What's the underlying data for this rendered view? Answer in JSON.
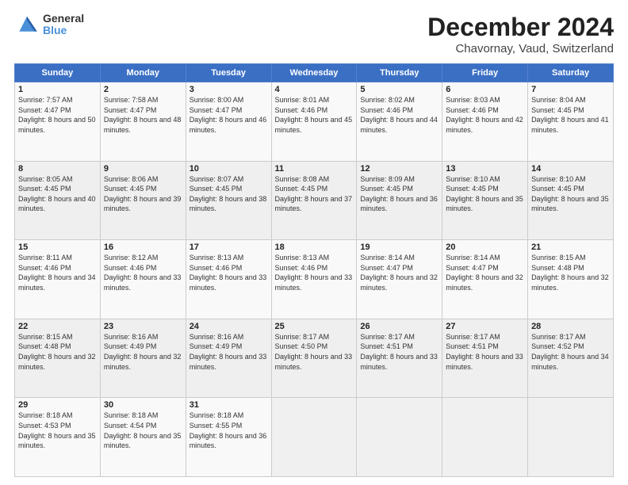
{
  "logo": {
    "line1": "General",
    "line2": "Blue"
  },
  "title": "December 2024",
  "subtitle": "Chavornay, Vaud, Switzerland",
  "days_header": [
    "Sunday",
    "Monday",
    "Tuesday",
    "Wednesday",
    "Thursday",
    "Friday",
    "Saturday"
  ],
  "weeks": [
    [
      {
        "num": "1",
        "rise": "7:57 AM",
        "set": "4:47 PM",
        "daylight": "8 hours and 50 minutes."
      },
      {
        "num": "2",
        "rise": "7:58 AM",
        "set": "4:47 PM",
        "daylight": "8 hours and 48 minutes."
      },
      {
        "num": "3",
        "rise": "8:00 AM",
        "set": "4:47 PM",
        "daylight": "8 hours and 46 minutes."
      },
      {
        "num": "4",
        "rise": "8:01 AM",
        "set": "4:46 PM",
        "daylight": "8 hours and 45 minutes."
      },
      {
        "num": "5",
        "rise": "8:02 AM",
        "set": "4:46 PM",
        "daylight": "8 hours and 44 minutes."
      },
      {
        "num": "6",
        "rise": "8:03 AM",
        "set": "4:46 PM",
        "daylight": "8 hours and 42 minutes."
      },
      {
        "num": "7",
        "rise": "8:04 AM",
        "set": "4:45 PM",
        "daylight": "8 hours and 41 minutes."
      }
    ],
    [
      {
        "num": "8",
        "rise": "8:05 AM",
        "set": "4:45 PM",
        "daylight": "8 hours and 40 minutes."
      },
      {
        "num": "9",
        "rise": "8:06 AM",
        "set": "4:45 PM",
        "daylight": "8 hours and 39 minutes."
      },
      {
        "num": "10",
        "rise": "8:07 AM",
        "set": "4:45 PM",
        "daylight": "8 hours and 38 minutes."
      },
      {
        "num": "11",
        "rise": "8:08 AM",
        "set": "4:45 PM",
        "daylight": "8 hours and 37 minutes."
      },
      {
        "num": "12",
        "rise": "8:09 AM",
        "set": "4:45 PM",
        "daylight": "8 hours and 36 minutes."
      },
      {
        "num": "13",
        "rise": "8:10 AM",
        "set": "4:45 PM",
        "daylight": "8 hours and 35 minutes."
      },
      {
        "num": "14",
        "rise": "8:10 AM",
        "set": "4:45 PM",
        "daylight": "8 hours and 35 minutes."
      }
    ],
    [
      {
        "num": "15",
        "rise": "8:11 AM",
        "set": "4:46 PM",
        "daylight": "8 hours and 34 minutes."
      },
      {
        "num": "16",
        "rise": "8:12 AM",
        "set": "4:46 PM",
        "daylight": "8 hours and 33 minutes."
      },
      {
        "num": "17",
        "rise": "8:13 AM",
        "set": "4:46 PM",
        "daylight": "8 hours and 33 minutes."
      },
      {
        "num": "18",
        "rise": "8:13 AM",
        "set": "4:46 PM",
        "daylight": "8 hours and 33 minutes."
      },
      {
        "num": "19",
        "rise": "8:14 AM",
        "set": "4:47 PM",
        "daylight": "8 hours and 32 minutes."
      },
      {
        "num": "20",
        "rise": "8:14 AM",
        "set": "4:47 PM",
        "daylight": "8 hours and 32 minutes."
      },
      {
        "num": "21",
        "rise": "8:15 AM",
        "set": "4:48 PM",
        "daylight": "8 hours and 32 minutes."
      }
    ],
    [
      {
        "num": "22",
        "rise": "8:15 AM",
        "set": "4:48 PM",
        "daylight": "8 hours and 32 minutes."
      },
      {
        "num": "23",
        "rise": "8:16 AM",
        "set": "4:49 PM",
        "daylight": "8 hours and 32 minutes."
      },
      {
        "num": "24",
        "rise": "8:16 AM",
        "set": "4:49 PM",
        "daylight": "8 hours and 33 minutes."
      },
      {
        "num": "25",
        "rise": "8:17 AM",
        "set": "4:50 PM",
        "daylight": "8 hours and 33 minutes."
      },
      {
        "num": "26",
        "rise": "8:17 AM",
        "set": "4:51 PM",
        "daylight": "8 hours and 33 minutes."
      },
      {
        "num": "27",
        "rise": "8:17 AM",
        "set": "4:51 PM",
        "daylight": "8 hours and 33 minutes."
      },
      {
        "num": "28",
        "rise": "8:17 AM",
        "set": "4:52 PM",
        "daylight": "8 hours and 34 minutes."
      }
    ],
    [
      {
        "num": "29",
        "rise": "8:18 AM",
        "set": "4:53 PM",
        "daylight": "8 hours and 35 minutes."
      },
      {
        "num": "30",
        "rise": "8:18 AM",
        "set": "4:54 PM",
        "daylight": "8 hours and 35 minutes."
      },
      {
        "num": "31",
        "rise": "8:18 AM",
        "set": "4:55 PM",
        "daylight": "8 hours and 36 minutes."
      },
      null,
      null,
      null,
      null
    ]
  ]
}
